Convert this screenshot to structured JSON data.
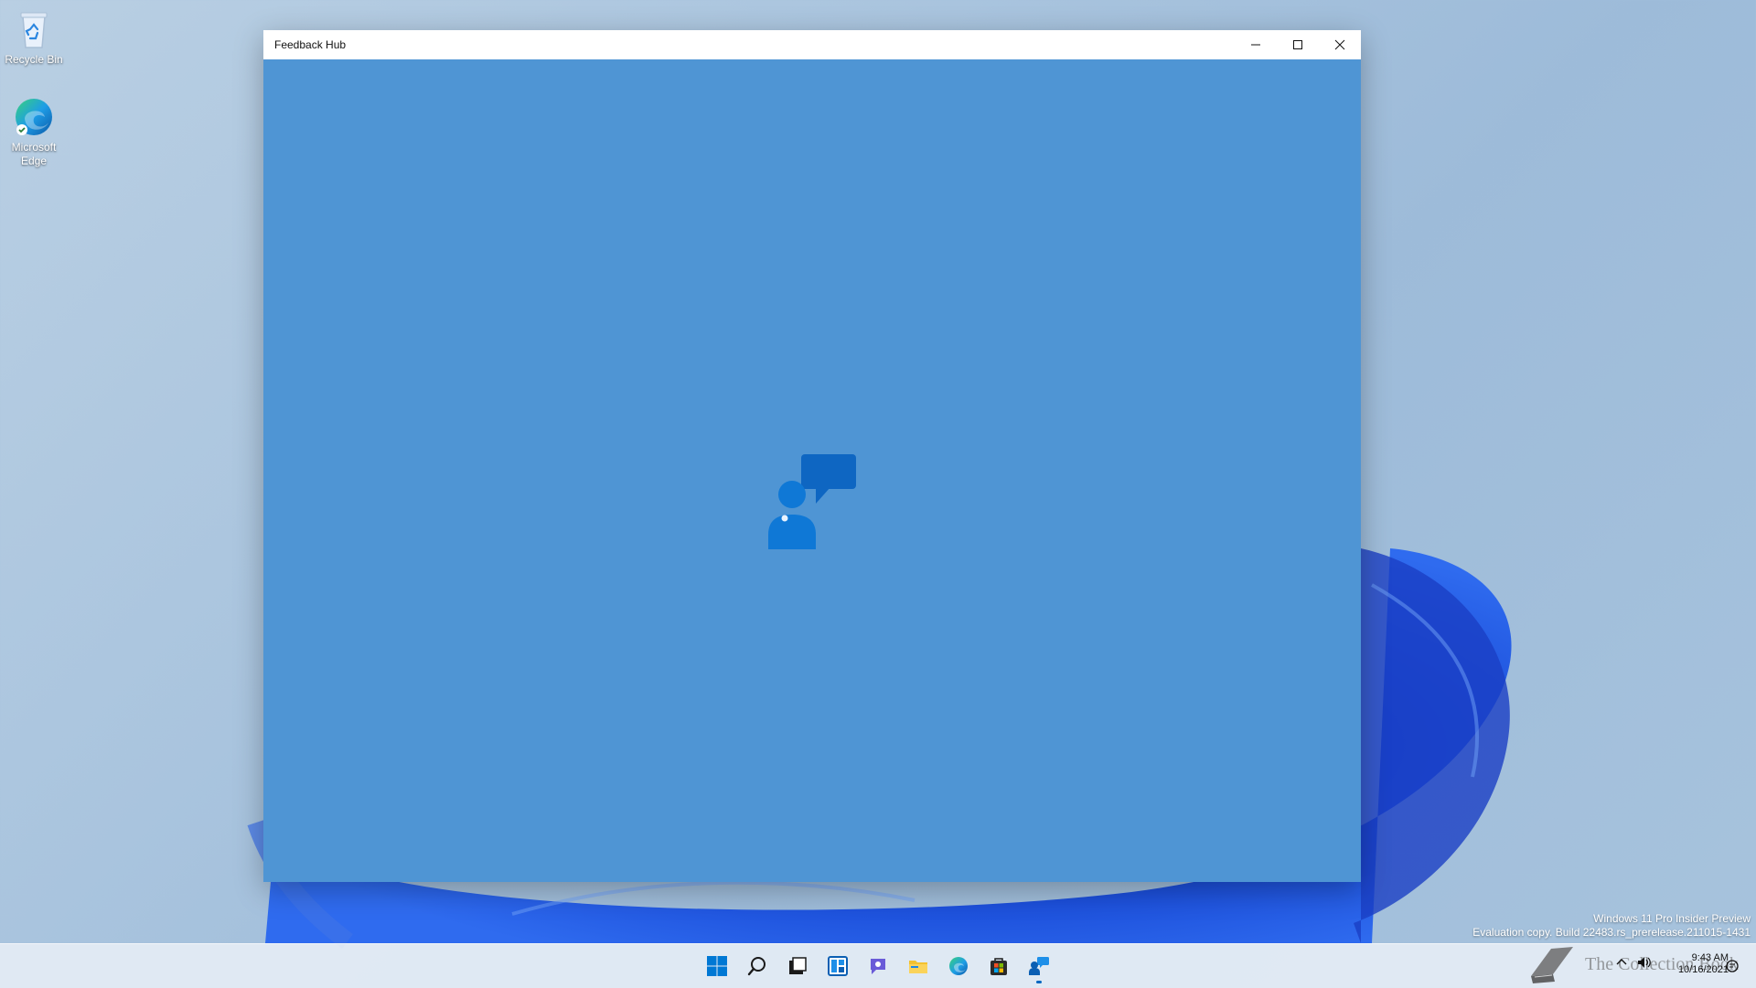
{
  "desktop": {
    "icons": [
      {
        "label": "Recycle Bin"
      },
      {
        "label": "Microsoft Edge"
      }
    ]
  },
  "window": {
    "title": "Feedback Hub",
    "controls": [
      "minimize-icon",
      "maximize-icon",
      "close-icon"
    ]
  },
  "watermark": {
    "line1": "Windows 11 Pro Insider Preview",
    "line2": "Evaluation copy. Build 22483.rs_prerelease.211015-1431"
  },
  "taskbar": {
    "apps": [
      "start",
      "search",
      "task-view",
      "widgets",
      "chat",
      "file-explorer",
      "edge",
      "store",
      "feedback-hub"
    ],
    "active_app": "feedback-hub",
    "brand_text": "The Collection Book",
    "clock": {
      "time": "9:43 AM",
      "date": "10/16/2021"
    }
  },
  "colors": {
    "window_bg": "#4f95d4",
    "taskbar_bg": "#e2eaf4",
    "accent": "#0067c0"
  }
}
